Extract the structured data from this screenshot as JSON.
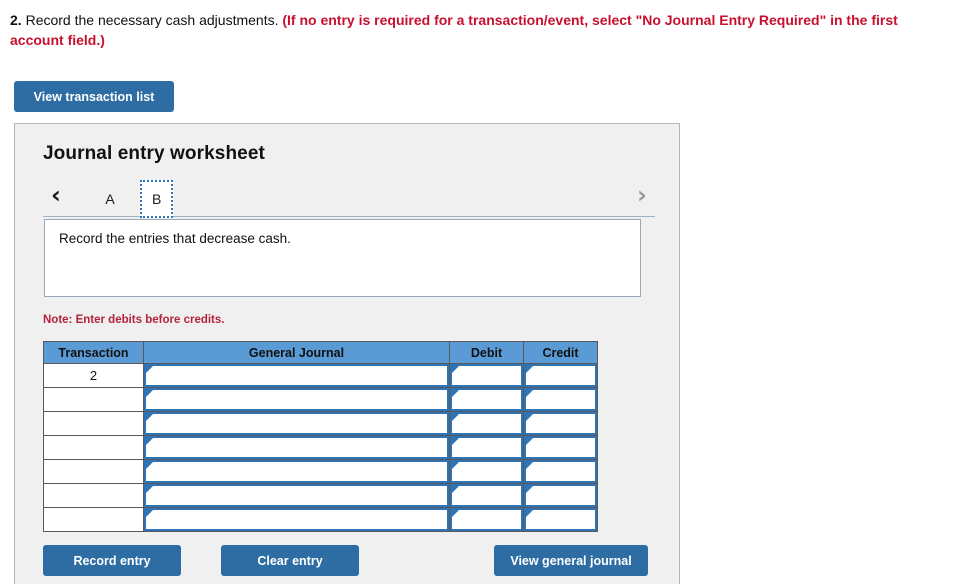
{
  "question": {
    "number": "2.",
    "text": " Record the necessary cash adjustments. ",
    "instruction": "(If no entry is required for a transaction/event, select \"No Journal Entry Required\" in the first account field.)"
  },
  "toolbar": {
    "view_transaction_list_label": "View transaction list"
  },
  "worksheet": {
    "title": "Journal entry worksheet",
    "nav": {
      "prev_icon": "chevron-left-icon",
      "prev_glyph": "‹",
      "next_icon": "chevron-right-icon",
      "next_glyph": "›"
    },
    "tabs": [
      {
        "label": "A",
        "active": false
      },
      {
        "label": "B",
        "active": true
      }
    ],
    "description": "Record the entries that decrease cash.",
    "note": "Note: Enter debits before credits.",
    "table": {
      "columns": [
        "Transaction",
        "General Journal",
        "Debit",
        "Credit"
      ],
      "rows": [
        {
          "transaction": "2",
          "general_journal": "",
          "debit": "",
          "credit": ""
        },
        {
          "transaction": "",
          "general_journal": "",
          "debit": "",
          "credit": ""
        },
        {
          "transaction": "",
          "general_journal": "",
          "debit": "",
          "credit": ""
        },
        {
          "transaction": "",
          "general_journal": "",
          "debit": "",
          "credit": ""
        },
        {
          "transaction": "",
          "general_journal": "",
          "debit": "",
          "credit": ""
        },
        {
          "transaction": "",
          "general_journal": "",
          "debit": "",
          "credit": ""
        },
        {
          "transaction": "",
          "general_journal": "",
          "debit": "",
          "credit": ""
        }
      ]
    },
    "actions": {
      "record_entry_label": "Record entry",
      "clear_entry_label": "Clear entry",
      "view_general_journal_label": "View general journal"
    }
  },
  "colors": {
    "button_blue": "#2e6da4",
    "table_header_blue": "#5b9bd5",
    "cell_border_blue": "#2e74b5",
    "note_red": "#b3243c",
    "instruction_red": "#c8102e",
    "panel_gray": "#f0f0f0"
  }
}
